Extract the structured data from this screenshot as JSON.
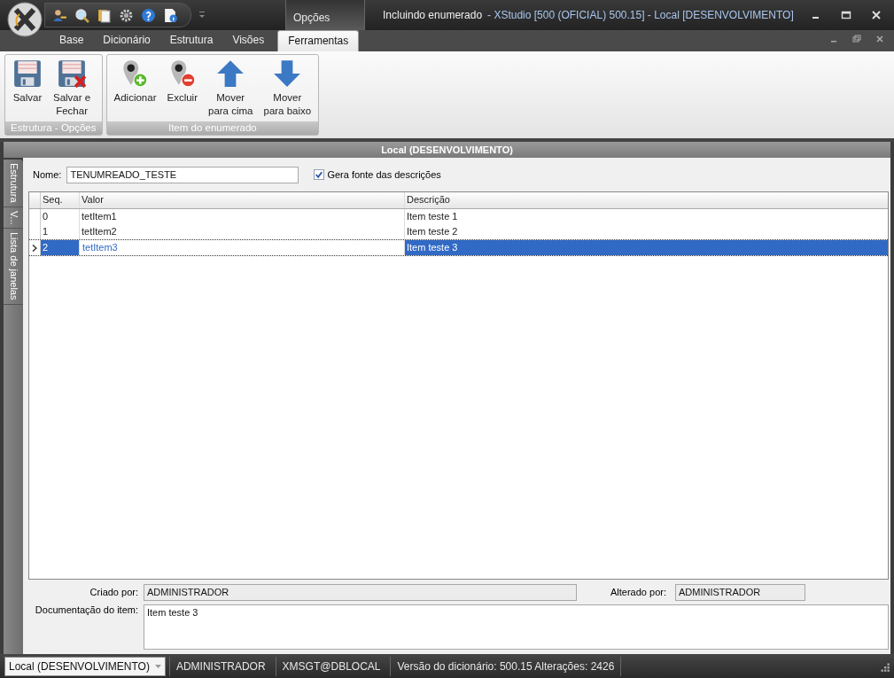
{
  "title_bar": {
    "contextual_tab": "Opções",
    "title": "Incluindo enumerado",
    "app_title": "- XStudio [500 (OFICIAL) 500.15] - Local [DESENVOLVIMENTO]"
  },
  "tabs": [
    {
      "label": "Base",
      "selected": false
    },
    {
      "label": "Dicionário",
      "selected": false
    },
    {
      "label": "Estrutura",
      "selected": false
    },
    {
      "label": "Visões",
      "selected": false
    },
    {
      "label": "Ferramentas",
      "selected": true
    }
  ],
  "ribbon": [
    {
      "label": "Estrutura - Opções",
      "buttons": [
        {
          "kind": "save",
          "label": "Salvar"
        },
        {
          "kind": "save-close",
          "label": "Salvar e\nFechar"
        }
      ]
    },
    {
      "label": "Item do enumerado",
      "buttons": [
        {
          "kind": "add",
          "label": "Adicionar"
        },
        {
          "kind": "delete",
          "label": "Excluir"
        },
        {
          "kind": "up",
          "label": "Mover\npara cima"
        },
        {
          "kind": "down",
          "label": "Mover\npara baixo"
        }
      ]
    }
  ],
  "panel_title": "Local (DESENVOLVIMENTO)",
  "side_tabs": [
    "Estrutura",
    "V...",
    "Lista de janelas"
  ],
  "form": {
    "name_label": "Nome:",
    "name_value": "TENUMREADO_TESTE",
    "checkbox": {
      "label": "Gera fonte das descrições",
      "checked": true
    }
  },
  "grid": {
    "columns": [
      "Seq.",
      "Valor",
      "Descrição"
    ],
    "rows": [
      {
        "cells": [
          "0",
          "tetItem1",
          "Item teste 1"
        ],
        "selected": false
      },
      {
        "cells": [
          "1",
          "tetItem2",
          "Item teste 2"
        ],
        "selected": false
      },
      {
        "cells": [
          "2",
          "tetItem3",
          "Item teste 3"
        ],
        "selected": true
      }
    ]
  },
  "footer": {
    "created_label": "Criado por:",
    "created_value": "ADMINISTRADOR",
    "altered_label": "Alterado por:",
    "altered_value": "ADMINISTRADOR",
    "doc_label": "Documentação do item:",
    "doc_value": "Item teste 3"
  },
  "status_bar": {
    "combo": "Local (DESENVOLVIMENTO)",
    "items": [
      "ADMINISTRADOR",
      "XMSGT@DBLOCAL",
      "Versão do dicionário: 500.15 Alterações: 2426"
    ]
  }
}
